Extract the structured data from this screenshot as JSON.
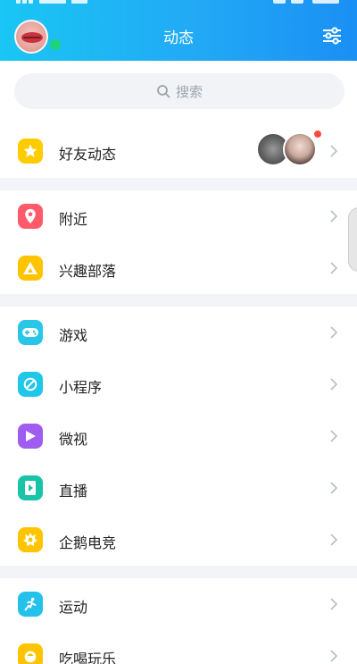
{
  "header": {
    "title": "动态",
    "filter_icon": "sliders-icon",
    "avatar_icon": "user-avatar",
    "online_status_color": "#1ed37a",
    "gradient_colors": [
      "#19c6f4",
      "#1a8ff4"
    ]
  },
  "search": {
    "placeholder": "搜索",
    "icon": "search-icon"
  },
  "friends_feed": {
    "label": "好友动态",
    "icon": "star-icon",
    "icon_color": "#ffcc00",
    "badge_color": "#ff4a3d"
  },
  "menu": {
    "group1": [
      {
        "label": "附近",
        "icon": "location-pin-icon",
        "icon_color": "#ff5a6a"
      },
      {
        "label": "兴趣部落",
        "icon": "triangle-tribe-icon",
        "icon_color": "#ffc400"
      }
    ],
    "group2": [
      {
        "label": "游戏",
        "icon": "gamepad-icon",
        "icon_color": "#28c7e8"
      },
      {
        "label": "小程序",
        "icon": "mini-program-icon",
        "icon_color": "#20c7e8"
      },
      {
        "label": "微视",
        "icon": "video-play-icon",
        "icon_color": "#a05bf0"
      },
      {
        "label": "直播",
        "icon": "live-stream-icon",
        "icon_color": "#18c3a6"
      },
      {
        "label": "企鹅电竞",
        "icon": "esports-icon",
        "icon_color": "#ffc400"
      }
    ],
    "group3": [
      {
        "label": "运动",
        "icon": "running-icon",
        "icon_color": "#24c2ea"
      },
      {
        "label": "吃喝玩乐",
        "icon": "food-icon",
        "icon_color": "#ffc400"
      }
    ]
  }
}
